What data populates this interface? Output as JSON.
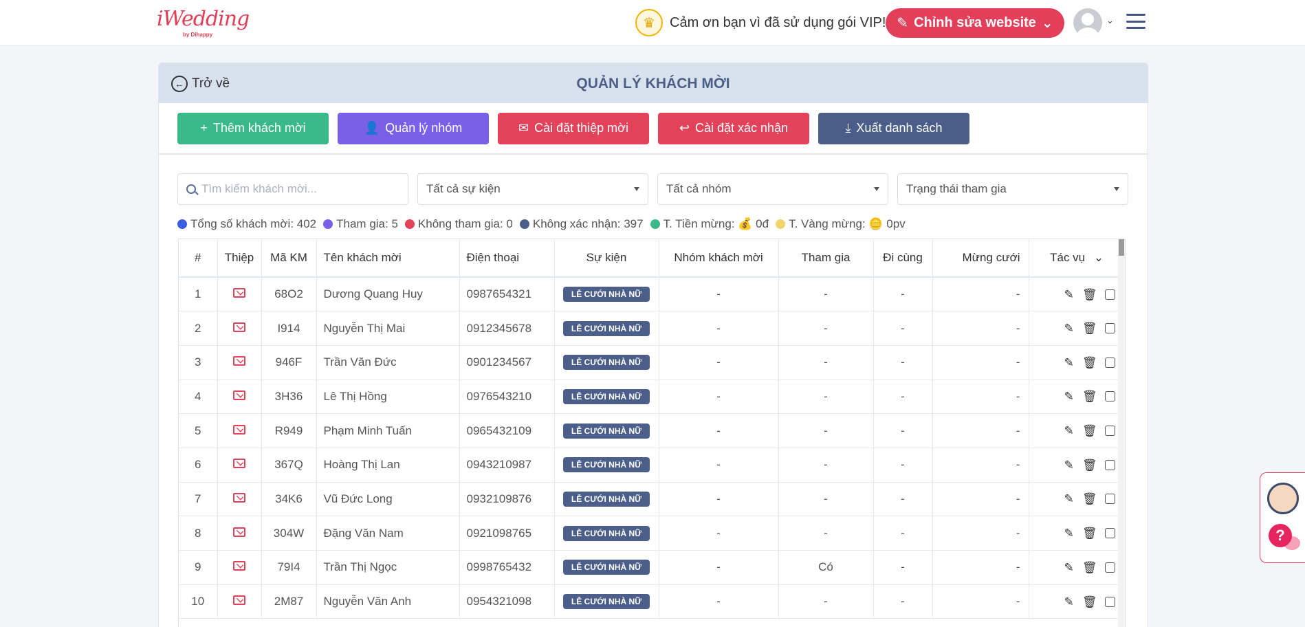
{
  "header": {
    "logo": "iWedding",
    "logo_sub": "by Dihappy",
    "vip_text": "Cảm ơn bạn vì đã sử dụng gói VIP!",
    "edit_site": "Chỉnh sửa website"
  },
  "panel": {
    "back": "Trở về",
    "title": "QUẢN LÝ KHÁCH MỜI"
  },
  "actions": {
    "add": "Thêm khách mời",
    "groups": "Quản lý nhóm",
    "card": "Cài đặt thiệp mời",
    "confirm": "Cài đặt xác nhận",
    "export": "Xuất danh sách"
  },
  "filters": {
    "search_placeholder": "Tìm kiếm khách mời...",
    "event": "Tất cả sự kiện",
    "group": "Tất cả nhóm",
    "status": "Trạng thái tham gia"
  },
  "stats": {
    "total": "Tổng số khách mời: 402",
    "attending": "Tham gia: 5",
    "not_attending": "Không tham gia: 0",
    "unconfirmed": "Không xác nhận: 397",
    "money": "T. Tiền mừng: 💰 0đ",
    "gold": "T. Vàng mừng: 🪙 0pv",
    "colors": {
      "total": "#3a5fe0",
      "attending": "#7a60e8",
      "not_attending": "#e2425a",
      "unconfirmed": "#4a5e89",
      "money": "#39b88a",
      "gold": "#f3d36b"
    }
  },
  "table": {
    "headers": {
      "num": "#",
      "card": "Thiệp",
      "code": "Mã KM",
      "name": "Tên khách mời",
      "phone": "Điện thoại",
      "event": "Sự kiện",
      "group": "Nhóm khách mời",
      "attend": "Tham gia",
      "with": "Đi cùng",
      "gift": "Mừng cưới",
      "action": "Tác vụ"
    },
    "rows": [
      {
        "num": "1",
        "code": "68O2",
        "name": "Dương Quang Huy",
        "phone": "0987654321",
        "event": "LỄ CƯỚI NHÀ NỮ",
        "group": "-",
        "attend": "-",
        "with": "-",
        "gift": "-"
      },
      {
        "num": "2",
        "code": "I914",
        "name": "Nguyễn Thị Mai",
        "phone": "0912345678",
        "event": "LỄ CƯỚI NHÀ NỮ",
        "group": "-",
        "attend": "-",
        "with": "-",
        "gift": "-"
      },
      {
        "num": "3",
        "code": "946F",
        "name": "Trần Văn Đức",
        "phone": "0901234567",
        "event": "LỄ CƯỚI NHÀ NỮ",
        "group": "-",
        "attend": "-",
        "with": "-",
        "gift": "-"
      },
      {
        "num": "4",
        "code": "3H36",
        "name": "Lê Thị Hồng",
        "phone": "0976543210",
        "event": "LỄ CƯỚI NHÀ NỮ",
        "group": "-",
        "attend": "-",
        "with": "-",
        "gift": "-"
      },
      {
        "num": "5",
        "code": "R949",
        "name": "Phạm Minh Tuấn",
        "phone": "0965432109",
        "event": "LỄ CƯỚI NHÀ NỮ",
        "group": "-",
        "attend": "-",
        "with": "-",
        "gift": "-"
      },
      {
        "num": "6",
        "code": "367Q",
        "name": "Hoàng Thị Lan",
        "phone": "0943210987",
        "event": "LỄ CƯỚI NHÀ NỮ",
        "group": "-",
        "attend": "-",
        "with": "-",
        "gift": "-"
      },
      {
        "num": "7",
        "code": "34K6",
        "name": "Vũ Đức Long",
        "phone": "0932109876",
        "event": "LỄ CƯỚI NHÀ NỮ",
        "group": "-",
        "attend": "-",
        "with": "-",
        "gift": "-"
      },
      {
        "num": "8",
        "code": "304W",
        "name": "Đặng Văn Nam",
        "phone": "0921098765",
        "event": "LỄ CƯỚI NHÀ NỮ",
        "group": "-",
        "attend": "-",
        "with": "-",
        "gift": "-"
      },
      {
        "num": "9",
        "code": "79I4",
        "name": "Trần Thị Ngọc",
        "phone": "0998765432",
        "event": "LỄ CƯỚI NHÀ NỮ",
        "group": "-",
        "attend": "Có",
        "with": "-",
        "gift": "-"
      },
      {
        "num": "10",
        "code": "2M87",
        "name": "Nguyễn Văn Anh",
        "phone": "0954321098",
        "event": "LỄ CƯỚI NHÀ NỮ",
        "group": "-",
        "attend": "-",
        "with": "-",
        "gift": "-"
      }
    ]
  },
  "helper": {
    "question": "?"
  }
}
